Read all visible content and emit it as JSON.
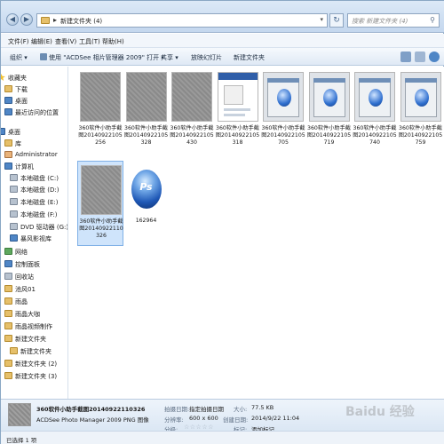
{
  "address": {
    "path": "新建文件夹 (4)"
  },
  "search": {
    "placeholder": "搜索 新建文件夹 (4)"
  },
  "menu": [
    "文件(F)",
    "编辑(E)",
    "查看(V)",
    "工具(T)",
    "帮助(H)"
  ],
  "toolbar": {
    "organize": "组织",
    "open_with": "使用 \"ACDSee 相片管理器 2009\" 打开",
    "share": "共享",
    "slideshow": "放映幻灯片",
    "new_folder": "新建文件夹"
  },
  "sidebar": {
    "items": [
      {
        "label": "收藏夹",
        "icon": "star-icon"
      },
      {
        "label": "下载",
        "icon": "download-folder-icon"
      },
      {
        "label": "桌面",
        "icon": "desktop-icon"
      },
      {
        "label": "最近访问的位置",
        "icon": "recent-places-icon"
      },
      {
        "label": "桌面",
        "icon": "desktop-icon"
      },
      {
        "label": "库",
        "icon": "library-icon"
      },
      {
        "label": "Administrator",
        "icon": "user-icon"
      },
      {
        "label": "计算机",
        "icon": "computer-icon"
      },
      {
        "label": "本地磁盘 (C:)",
        "icon": "drive-icon"
      },
      {
        "label": "本地磁盘 (D:)",
        "icon": "drive-icon"
      },
      {
        "label": "本地磁盘 (E:)",
        "icon": "drive-icon"
      },
      {
        "label": "本地磁盘 (F:)",
        "icon": "drive-icon"
      },
      {
        "label": "DVD 驱动器 (G:)",
        "icon": "dvd-drive-icon"
      },
      {
        "label": "暴风影视库",
        "icon": "media-library-icon"
      },
      {
        "label": "网络",
        "icon": "network-icon"
      },
      {
        "label": "控制面板",
        "icon": "control-panel-icon"
      },
      {
        "label": "回收站",
        "icon": "recycle-bin-icon"
      },
      {
        "label": "池风01",
        "icon": "folder-icon"
      },
      {
        "label": "雨晶",
        "icon": "folder-icon"
      },
      {
        "label": "雨晶大咖",
        "icon": "folder-icon"
      },
      {
        "label": "雨晶视频制作",
        "icon": "folder-icon"
      },
      {
        "label": "新建文件夹",
        "icon": "folder-icon"
      },
      {
        "label": "新建文件夹",
        "icon": "folder-icon"
      },
      {
        "label": "新建文件夹 (2)",
        "icon": "folder-icon"
      },
      {
        "label": "新建文件夹 (3)",
        "icon": "folder-icon"
      }
    ]
  },
  "files": [
    {
      "name": "360软件小助手截图20140922105256",
      "kind": "gray"
    },
    {
      "name": "360软件小助手截图20140922105328",
      "kind": "gray"
    },
    {
      "name": "360软件小助手截图20140922105430",
      "kind": "gray"
    },
    {
      "name": "360软件小助手截图20140922105318",
      "kind": "doc"
    },
    {
      "name": "360软件小助手截图20140922105705",
      "kind": "shot"
    },
    {
      "name": "360软件小助手截图20140922105719",
      "kind": "shot"
    },
    {
      "name": "360软件小助手截图20140922105740",
      "kind": "shot"
    },
    {
      "name": "360软件小助手截图20140922105759",
      "kind": "shot"
    },
    {
      "name": "360软件小助手截图20140922110326",
      "kind": "gray",
      "selected": true
    },
    {
      "name": "162964",
      "kind": "ps"
    }
  ],
  "details": {
    "filename": "360软件小助手截图20140922110326",
    "type": "ACDSee Photo Manager 2009 PNG 图像",
    "date_taken_key": "拍摄日期:",
    "date_taken_value": "指定拍摄日期",
    "dimensions_key": "分辨率:",
    "dimensions_value": "600 x 600",
    "size_key": "大小:",
    "size_value": "77.5 KB",
    "created_key": "创建日期:",
    "created_value": "2014/9/22 11:04",
    "rating_key": "分级:",
    "rating_stars": "☆☆☆☆☆",
    "tags_key": "标记:",
    "tags_value": "添加标记"
  },
  "status": {
    "text": "已选择 1 项"
  },
  "watermark": "Baidu 经验"
}
